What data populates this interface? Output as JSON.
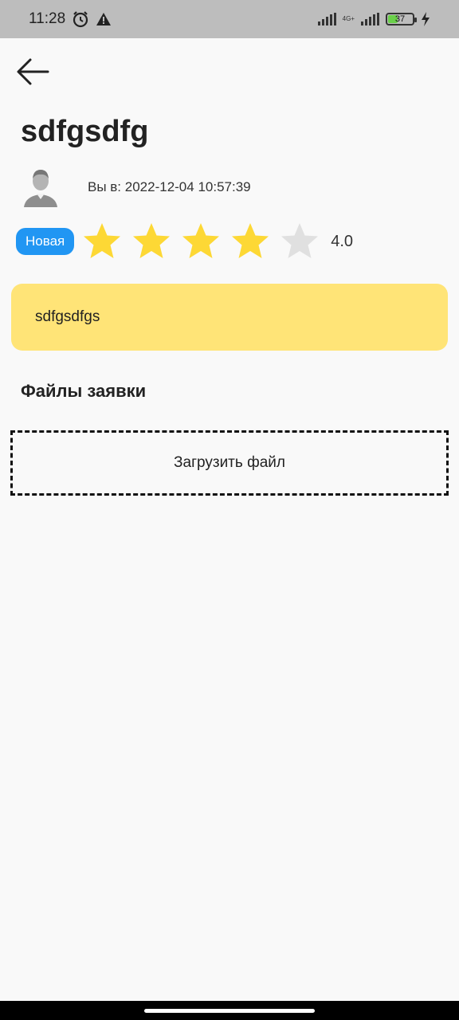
{
  "status_bar": {
    "time": "11:28",
    "icons": [
      "alarm-icon",
      "warning-icon"
    ],
    "network": "4G+",
    "battery": "37"
  },
  "header": {
    "back_icon": "arrow-left-icon"
  },
  "ticket": {
    "title": "sdfgsdfg",
    "date_label": "Вы в: 2022-12-04 10:57:39",
    "status_badge": "Новая",
    "rating": 4,
    "rating_value": "4.0",
    "description": "sdfgsdfgs"
  },
  "files": {
    "heading": "Файлы заявки",
    "upload_label": "Загрузить файл"
  },
  "colors": {
    "accent_blue": "#2196f3",
    "card_yellow": "#ffe477",
    "star_filled": "#fdd835",
    "star_empty": "#e0e0e0"
  }
}
